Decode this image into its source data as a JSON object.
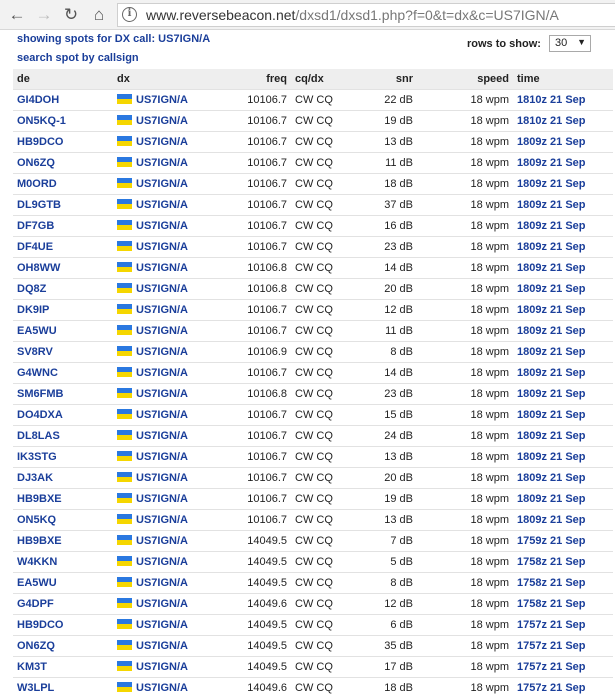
{
  "browser": {
    "url_host": "www.reversebeacon.net",
    "url_rest": "/dxsd1/dxsd1.php?f=0&t=dx&c=US7IGN/A",
    "info_glyph": "i"
  },
  "page": {
    "showing_label": "showing spots for DX call: US7IGN/A",
    "search_label": "search spot by callsign",
    "rows_label": "rows to show:",
    "rows_value": "30"
  },
  "table": {
    "headers": {
      "de": "de",
      "dx": "dx",
      "freq": "freq",
      "cqdx": "cq/dx",
      "snr": "snr",
      "speed": "speed",
      "time": "time"
    },
    "rows": [
      {
        "de": "GI4DOH",
        "dx": "US7IGN/A",
        "freq": "10106.7",
        "cqdx": "CW CQ",
        "snr": "22 dB",
        "speed": "18 wpm",
        "time": "1810z 21 Sep"
      },
      {
        "de": "ON5KQ-1",
        "dx": "US7IGN/A",
        "freq": "10106.7",
        "cqdx": "CW CQ",
        "snr": "19 dB",
        "speed": "18 wpm",
        "time": "1810z 21 Sep"
      },
      {
        "de": "HB9DCO",
        "dx": "US7IGN/A",
        "freq": "10106.7",
        "cqdx": "CW CQ",
        "snr": "13 dB",
        "speed": "18 wpm",
        "time": "1809z 21 Sep"
      },
      {
        "de": "ON6ZQ",
        "dx": "US7IGN/A",
        "freq": "10106.7",
        "cqdx": "CW CQ",
        "snr": "11 dB",
        "speed": "18 wpm",
        "time": "1809z 21 Sep"
      },
      {
        "de": "M0ORD",
        "dx": "US7IGN/A",
        "freq": "10106.7",
        "cqdx": "CW CQ",
        "snr": "18 dB",
        "speed": "18 wpm",
        "time": "1809z 21 Sep"
      },
      {
        "de": "DL9GTB",
        "dx": "US7IGN/A",
        "freq": "10106.7",
        "cqdx": "CW CQ",
        "snr": "37 dB",
        "speed": "18 wpm",
        "time": "1809z 21 Sep"
      },
      {
        "de": "DF7GB",
        "dx": "US7IGN/A",
        "freq": "10106.7",
        "cqdx": "CW CQ",
        "snr": "16 dB",
        "speed": "18 wpm",
        "time": "1809z 21 Sep"
      },
      {
        "de": "DF4UE",
        "dx": "US7IGN/A",
        "freq": "10106.7",
        "cqdx": "CW CQ",
        "snr": "23 dB",
        "speed": "18 wpm",
        "time": "1809z 21 Sep"
      },
      {
        "de": "OH8WW",
        "dx": "US7IGN/A",
        "freq": "10106.8",
        "cqdx": "CW CQ",
        "snr": "14 dB",
        "speed": "18 wpm",
        "time": "1809z 21 Sep"
      },
      {
        "de": "DQ8Z",
        "dx": "US7IGN/A",
        "freq": "10106.8",
        "cqdx": "CW CQ",
        "snr": "20 dB",
        "speed": "18 wpm",
        "time": "1809z 21 Sep"
      },
      {
        "de": "DK9IP",
        "dx": "US7IGN/A",
        "freq": "10106.7",
        "cqdx": "CW CQ",
        "snr": "12 dB",
        "speed": "18 wpm",
        "time": "1809z 21 Sep"
      },
      {
        "de": "EA5WU",
        "dx": "US7IGN/A",
        "freq": "10106.7",
        "cqdx": "CW CQ",
        "snr": "11 dB",
        "speed": "18 wpm",
        "time": "1809z 21 Sep"
      },
      {
        "de": "SV8RV",
        "dx": "US7IGN/A",
        "freq": "10106.9",
        "cqdx": "CW CQ",
        "snr": "8 dB",
        "speed": "18 wpm",
        "time": "1809z 21 Sep"
      },
      {
        "de": "G4WNC",
        "dx": "US7IGN/A",
        "freq": "10106.7",
        "cqdx": "CW CQ",
        "snr": "14 dB",
        "speed": "18 wpm",
        "time": "1809z 21 Sep"
      },
      {
        "de": "SM6FMB",
        "dx": "US7IGN/A",
        "freq": "10106.8",
        "cqdx": "CW CQ",
        "snr": "23 dB",
        "speed": "18 wpm",
        "time": "1809z 21 Sep"
      },
      {
        "de": "DO4DXA",
        "dx": "US7IGN/A",
        "freq": "10106.7",
        "cqdx": "CW CQ",
        "snr": "15 dB",
        "speed": "18 wpm",
        "time": "1809z 21 Sep"
      },
      {
        "de": "DL8LAS",
        "dx": "US7IGN/A",
        "freq": "10106.7",
        "cqdx": "CW CQ",
        "snr": "24 dB",
        "speed": "18 wpm",
        "time": "1809z 21 Sep"
      },
      {
        "de": "IK3STG",
        "dx": "US7IGN/A",
        "freq": "10106.7",
        "cqdx": "CW CQ",
        "snr": "13 dB",
        "speed": "18 wpm",
        "time": "1809z 21 Sep"
      },
      {
        "de": "DJ3AK",
        "dx": "US7IGN/A",
        "freq": "10106.7",
        "cqdx": "CW CQ",
        "snr": "20 dB",
        "speed": "18 wpm",
        "time": "1809z 21 Sep"
      },
      {
        "de": "HB9BXE",
        "dx": "US7IGN/A",
        "freq": "10106.7",
        "cqdx": "CW CQ",
        "snr": "19 dB",
        "speed": "18 wpm",
        "time": "1809z 21 Sep"
      },
      {
        "de": "ON5KQ",
        "dx": "US7IGN/A",
        "freq": "10106.7",
        "cqdx": "CW CQ",
        "snr": "13 dB",
        "speed": "18 wpm",
        "time": "1809z 21 Sep"
      },
      {
        "de": "HB9BXE",
        "dx": "US7IGN/A",
        "freq": "14049.5",
        "cqdx": "CW CQ",
        "snr": "7 dB",
        "speed": "18 wpm",
        "time": "1759z 21 Sep"
      },
      {
        "de": "W4KKN",
        "dx": "US7IGN/A",
        "freq": "14049.5",
        "cqdx": "CW CQ",
        "snr": "5 dB",
        "speed": "18 wpm",
        "time": "1758z 21 Sep"
      },
      {
        "de": "EA5WU",
        "dx": "US7IGN/A",
        "freq": "14049.5",
        "cqdx": "CW CQ",
        "snr": "8 dB",
        "speed": "18 wpm",
        "time": "1758z 21 Sep"
      },
      {
        "de": "G4DPF",
        "dx": "US7IGN/A",
        "freq": "14049.6",
        "cqdx": "CW CQ",
        "snr": "12 dB",
        "speed": "18 wpm",
        "time": "1758z 21 Sep"
      },
      {
        "de": "HB9DCO",
        "dx": "US7IGN/A",
        "freq": "14049.5",
        "cqdx": "CW CQ",
        "snr": "6 dB",
        "speed": "18 wpm",
        "time": "1757z 21 Sep"
      },
      {
        "de": "ON6ZQ",
        "dx": "US7IGN/A",
        "freq": "14049.5",
        "cqdx": "CW CQ",
        "snr": "35 dB",
        "speed": "18 wpm",
        "time": "1757z 21 Sep"
      },
      {
        "de": "KM3T",
        "dx": "US7IGN/A",
        "freq": "14049.5",
        "cqdx": "CW CQ",
        "snr": "17 dB",
        "speed": "18 wpm",
        "time": "1757z 21 Sep"
      },
      {
        "de": "W3LPL",
        "dx": "US7IGN/A",
        "freq": "14049.6",
        "cqdx": "CW CQ",
        "snr": "18 dB",
        "speed": "18 wpm",
        "time": "1757z 21 Sep"
      }
    ]
  }
}
